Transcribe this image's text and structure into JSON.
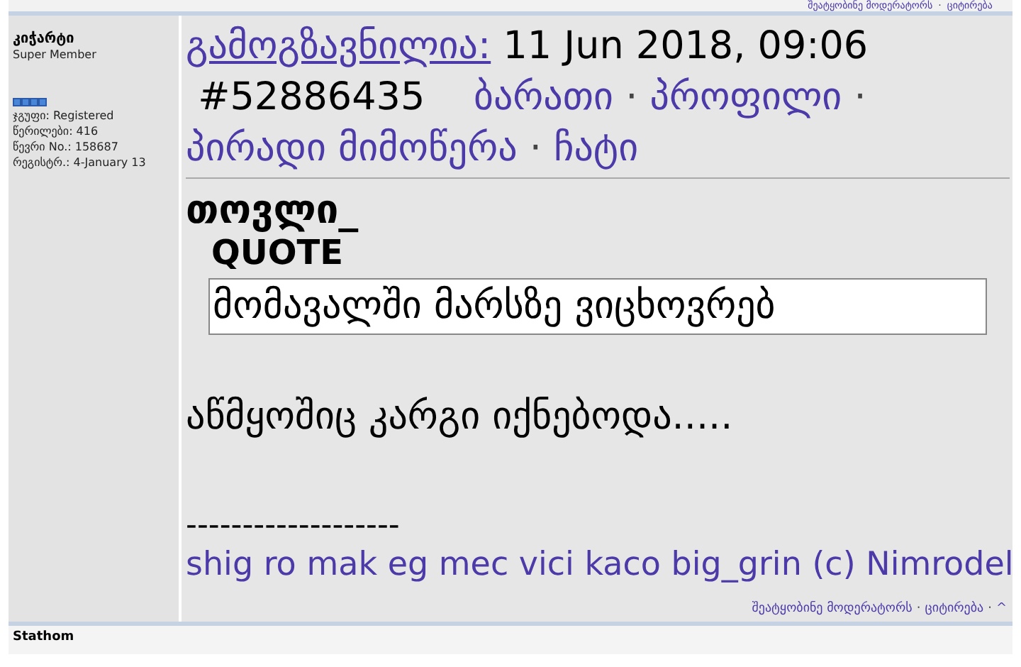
{
  "top_bar": {
    "links": [
      "შეატყობინე მოდერატორს",
      "ციტირება"
    ],
    "separator": "·"
  },
  "post": {
    "author": {
      "name": "კიჭარტი",
      "rank": "Super Member",
      "details": [
        "ჯგუფი: Registered",
        "წერილები: 416",
        "წევრი No.: 158687",
        "რეგისტრ.: 4-January 13"
      ]
    },
    "header": {
      "label": "გამოგზავნილია:",
      "date": "11 Jun 2018, 09:06",
      "post_number": "#52886435",
      "links": [
        "ბარათი",
        "პროფილი",
        "პირადი მიმოწერა",
        "ჩატი"
      ],
      "separator": "·"
    },
    "quote": {
      "author": "თოვლი_",
      "label": "QUOTE",
      "text": "მომავალში მარსზე ვიცხოვრებ"
    },
    "body": "აწმყოშიც კარგი იქნებოდა.....",
    "signature_rule": "-------------------",
    "signature": "shig ro mak eg mec vici kaco big_grin (c) Nimrodel"
  },
  "footer": {
    "links": [
      "შეატყობინე მოდერატორს",
      "ციტირება",
      "^"
    ],
    "separator": "·"
  },
  "next_author": "Stathom"
}
